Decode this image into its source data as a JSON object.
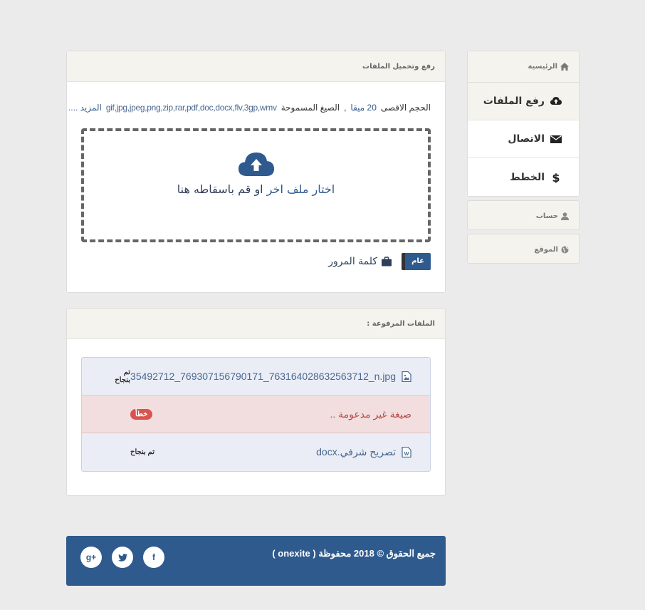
{
  "sidebar": {
    "home_label": "الرئيسية",
    "items": [
      {
        "label": "رفع الملفات",
        "icon": "cloud-upload-icon"
      },
      {
        "label": "الاتصال",
        "icon": "envelope-icon"
      },
      {
        "label": "الخطط",
        "icon": "dollar-icon"
      }
    ],
    "account_label": "حساب",
    "site_label": "الموقع"
  },
  "upload": {
    "title": "رفع وتحميل الملفات",
    "max_label": "الحجم الاقصى",
    "max_value": "20 ميقا",
    "sep": ",",
    "formats_label": "الصيغ المسموحة",
    "formats": "gif,jpg,jpeg,png,zip,rar,pdf,doc,docx,flv,3gp,wmv",
    "more": "المزيد ....",
    "drop_text_a": "اختار ملف اخر",
    "drop_text_b": "او قم باسقاطه هنا",
    "toggle_label": "عام",
    "password_label": "كلمة المرور"
  },
  "files": {
    "title": "الملفات المرفوعة :",
    "rows": [
      {
        "name": "35492712_769307156790171_763164028632563712_n.jpg",
        "status": "تم بنجاح"
      },
      {
        "name": "صيغة غير مدعومة ..",
        "status": "خطأ"
      },
      {
        "name": "تصريح شرفي.docx",
        "status": "تم بنجاح"
      }
    ]
  },
  "footer": {
    "copyright": "جميع الحقوق © 2018 محفوظة ( onexite )",
    "social": [
      "f",
      "t",
      "g+"
    ]
  }
}
